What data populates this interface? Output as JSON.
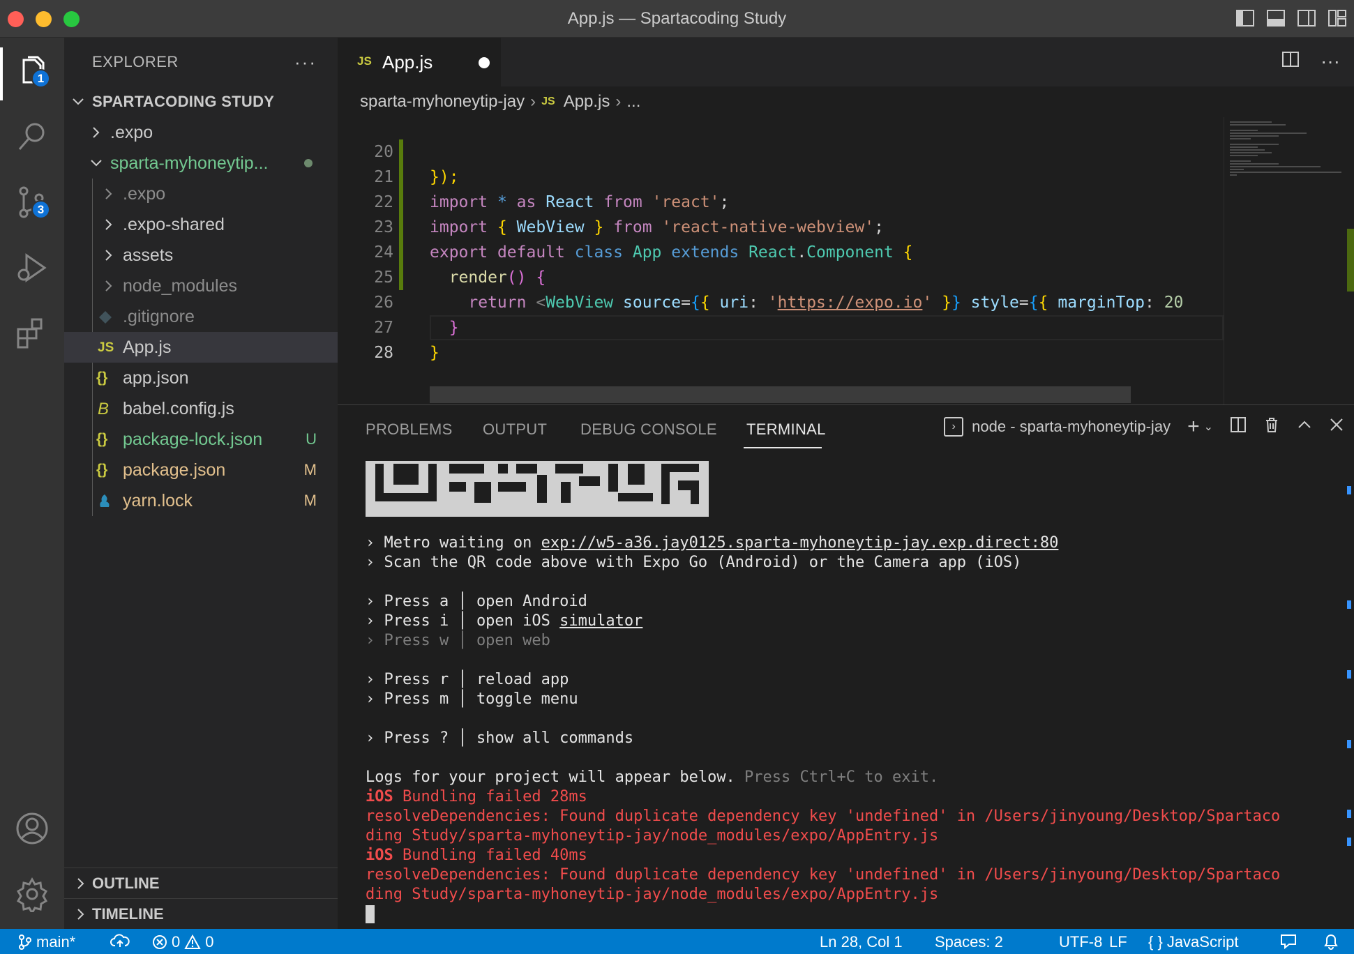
{
  "window": {
    "title": "App.js — Spartacoding Study"
  },
  "activity": {
    "explorer_badge": "1",
    "scm_badge": "3"
  },
  "sidebar": {
    "title": "EXPLORER",
    "more": "···",
    "root": "SPARTACODING STUDY",
    "items": [
      {
        "label": ".expo",
        "kind": "folder",
        "level": 1
      },
      {
        "label": "sparta-myhoneytip...",
        "kind": "folder-open",
        "level": 1
      },
      {
        "label": ".expo",
        "kind": "folder",
        "level": 2
      },
      {
        "label": ".expo-shared",
        "kind": "folder",
        "level": 2
      },
      {
        "label": "assets",
        "kind": "folder",
        "level": 2
      },
      {
        "label": "node_modules",
        "kind": "folder",
        "level": 2
      },
      {
        "label": ".gitignore",
        "kind": "git",
        "level": 2
      },
      {
        "label": "App.js",
        "kind": "js",
        "level": 2
      },
      {
        "label": "app.json",
        "kind": "json",
        "level": 2
      },
      {
        "label": "babel.config.js",
        "kind": "babel",
        "level": 2
      },
      {
        "label": "package-lock.json",
        "kind": "json",
        "level": 2,
        "badge": "U"
      },
      {
        "label": "package.json",
        "kind": "json",
        "level": 2,
        "badge": "M"
      },
      {
        "label": "yarn.lock",
        "kind": "yarn",
        "level": 2,
        "badge": "M"
      }
    ],
    "outline": "OUTLINE",
    "timeline": "TIMELINE"
  },
  "editor": {
    "tab": {
      "icon": "JS",
      "name": "App.js"
    },
    "breadcrumb": {
      "folder": "sparta-myhoneytip-jay",
      "icon": "JS",
      "file": "App.js",
      "ellipsis": "..."
    },
    "line_numbers": [
      "20",
      "21",
      "22",
      "23",
      "24",
      "25",
      "26",
      "27",
      "28"
    ],
    "lines": {
      "l20": "});",
      "l21_import": "import",
      "l21_star": "*",
      "l21_as": "as",
      "l21_react": "React",
      "l21_from": "from",
      "l21_str": "'react'",
      "l21_semi": ";",
      "l22_import": "import",
      "l22_open": "{",
      "l22_webview": "WebView",
      "l22_close": "}",
      "l22_from": "from",
      "l22_str": "'react-native-webview'",
      "l22_semi": ";",
      "l23_export": "export",
      "l23_default": "default",
      "l23_class": "class",
      "l23_app": "App",
      "l23_extends": "extends",
      "l23_react": "React",
      "l23_dot": ".",
      "l23_component": "Component",
      "l23_brace": "{",
      "l24_render": "render",
      "l24_parens": "()",
      "l24_brace": "{",
      "l25_return": "return",
      "l25_lt": "<",
      "l25_webview": "WebView",
      "l25_source": "source",
      "l25_eq": "=",
      "l25_open1": "{",
      "l25_open2": "{",
      "l25_uri": "uri",
      "l25_colon": ":",
      "l25_q1": "'",
      "l25_url": "https://expo.io",
      "l25_q2": "'",
      "l25_close2": "}",
      "l25_close1": "}",
      "l25_style": "style",
      "l25_eq2": "=",
      "l25_sopen1": "{",
      "l25_sopen2": "{",
      "l25_margin": "marginTop",
      "l25_colon2": ":",
      "l25_num": "20",
      "l26": "}",
      "l27": "}"
    }
  },
  "panel": {
    "tabs": [
      "PROBLEMS",
      "OUTPUT",
      "DEBUG CONSOLE",
      "TERMINAL"
    ],
    "active_tab": "TERMINAL",
    "terminal_name": "node - sparta-myhoneytip-jay",
    "terminal": {
      "metro_prefix": "› Metro waiting on ",
      "metro_url": "exp://w5-a36.jay0125.sparta-myhoneytip-jay.exp.direct:80",
      "scan": "› Scan the QR code above with Expo Go (Android) or the Camera app (iOS)",
      "press_a": "› Press a │ open Android",
      "press_i_prefix": "› Press i │ open iOS ",
      "press_i_link": "simulator",
      "press_w": "› Press w │ open web",
      "press_r": "› Press r │ reload app",
      "press_m": "› Press m │ toggle menu",
      "press_q": "› Press ? │ show all commands",
      "logs": "Logs for your project will appear below.",
      "logs_hint": " Press Ctrl+C to exit.",
      "ios1": "iOS",
      "bundling1": " Bundling failed 28ms",
      "err1a": "resolveDependencies: Found duplicate dependency key 'undefined' in /Users/jinyoung/Desktop/Spartaco",
      "err1b": "ding Study/sparta-myhoneytip-jay/node_modules/expo/AppEntry.js",
      "ios2": "iOS",
      "bundling2": " Bundling failed 40ms",
      "err2a": "resolveDependencies: Found duplicate dependency key 'undefined' in /Users/jinyoung/Desktop/Spartaco",
      "err2b": "ding Study/sparta-myhoneytip-jay/node_modules/expo/AppEntry.js"
    }
  },
  "status": {
    "branch": "main*",
    "errors": "0",
    "warnings": "0",
    "position": "Ln 28, Col 1",
    "spaces": "Spaces: 2",
    "encoding": "UTF-8",
    "eol": "LF",
    "language": "JavaScript"
  },
  "colors": {
    "statusbar": "#007acc",
    "accent_badge": "#0e72d6",
    "untracked": "#73c991",
    "modified": "#e2c08d",
    "error": "#f14c4c"
  }
}
